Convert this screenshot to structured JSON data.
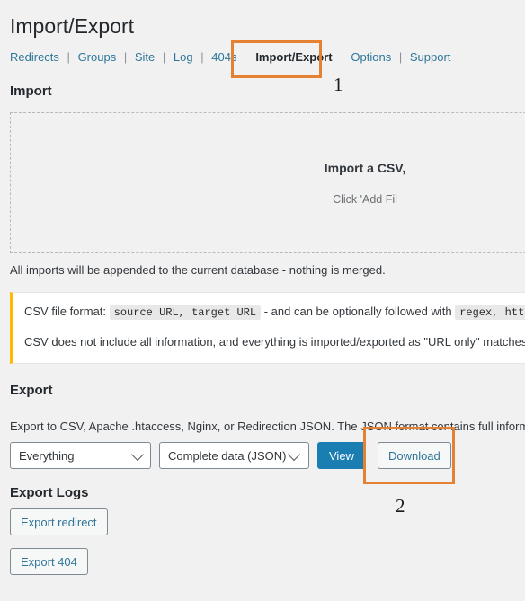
{
  "header": {
    "title": "Import/Export"
  },
  "subnav": {
    "items": [
      {
        "label": "Redirects",
        "current": false
      },
      {
        "label": "Groups",
        "current": false
      },
      {
        "label": "Site",
        "current": false
      },
      {
        "label": "Log",
        "current": false
      },
      {
        "label": "404s",
        "current": false
      },
      {
        "label": "Import/Export",
        "current": true
      },
      {
        "label": "Options",
        "current": false
      },
      {
        "label": "Support",
        "current": false
      }
    ],
    "separator": "|"
  },
  "annotations": {
    "marker_1": "1",
    "marker_2": "2",
    "highlight_color": "#e58133"
  },
  "import": {
    "title": "Import",
    "dropzone": {
      "title": "Import a CSV,",
      "subtitle": "Click 'Add Fil"
    },
    "note": "All imports will be appended to the current database - nothing is merged.",
    "notice": {
      "line1_prefix": "CSV file format:",
      "line1_code1": "source URL, target URL",
      "line1_middle": "- and can be optionally followed with",
      "line1_code2": "regex, htt",
      "line2": "CSV does not include all information, and everything is imported/exported as \"URL only\" matches",
      "accent_color": "#ffb900"
    }
  },
  "export": {
    "title": "Export",
    "note": "Export to CSV, Apache .htaccess, Nginx, or Redirection JSON. The JSON format contains full informat",
    "scope_select": {
      "value": "Everything"
    },
    "format_select": {
      "value": "Complete data (JSON)"
    },
    "view_button": "View",
    "download_button": "Download",
    "primary_color": "#1b7eb3"
  },
  "export_logs": {
    "title": "Export Logs",
    "buttons": [
      {
        "label": "Export redirect"
      },
      {
        "label": "Export 404"
      }
    ]
  }
}
